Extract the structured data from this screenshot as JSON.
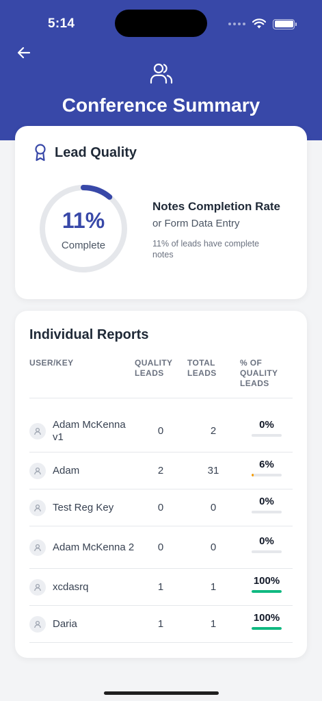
{
  "status_bar": {
    "time": "5:14"
  },
  "header": {
    "title": "Conference Summary",
    "icon": "users-icon",
    "back_icon": "back-arrow-icon"
  },
  "lead_quality": {
    "title": "Lead Quality",
    "icon": "award-ribbon-icon",
    "percent_text": "11%",
    "percent_value": 11,
    "complete_label": "Complete",
    "rate_title": "Notes Completion Rate",
    "rate_subtitle": "or Form Data Entry",
    "rate_description": "11% of leads have complete notes"
  },
  "reports": {
    "title": "Individual Reports",
    "columns": [
      "USER/KEY",
      "QUALITY\nLEADS",
      "TOTAL\nLEADS",
      "% OF\nQUALITY\nLEADS"
    ],
    "rows": [
      {
        "name": "Adam McKenna v1",
        "quality": "0",
        "total": "2",
        "pct": "0%",
        "pct_value": 0
      },
      {
        "name": "Adam",
        "quality": "2",
        "total": "31",
        "pct": "6%",
        "pct_value": 6
      },
      {
        "name": "Test Reg Key",
        "quality": "0",
        "total": "0",
        "pct": "0%",
        "pct_value": 0
      },
      {
        "name": "Adam McKenna 2",
        "quality": "0",
        "total": "0",
        "pct": "0%",
        "pct_value": 0
      },
      {
        "name": "xcdasrq",
        "quality": "1",
        "total": "1",
        "pct": "100%",
        "pct_value": 100
      },
      {
        "name": "Daria",
        "quality": "1",
        "total": "1",
        "pct": "100%",
        "pct_value": 100
      }
    ]
  },
  "colors": {
    "header": "#3848a8",
    "accent": "#3848a8",
    "progress_low": "#f59e0b",
    "progress_high": "#10b981",
    "track": "#e5e7eb"
  }
}
